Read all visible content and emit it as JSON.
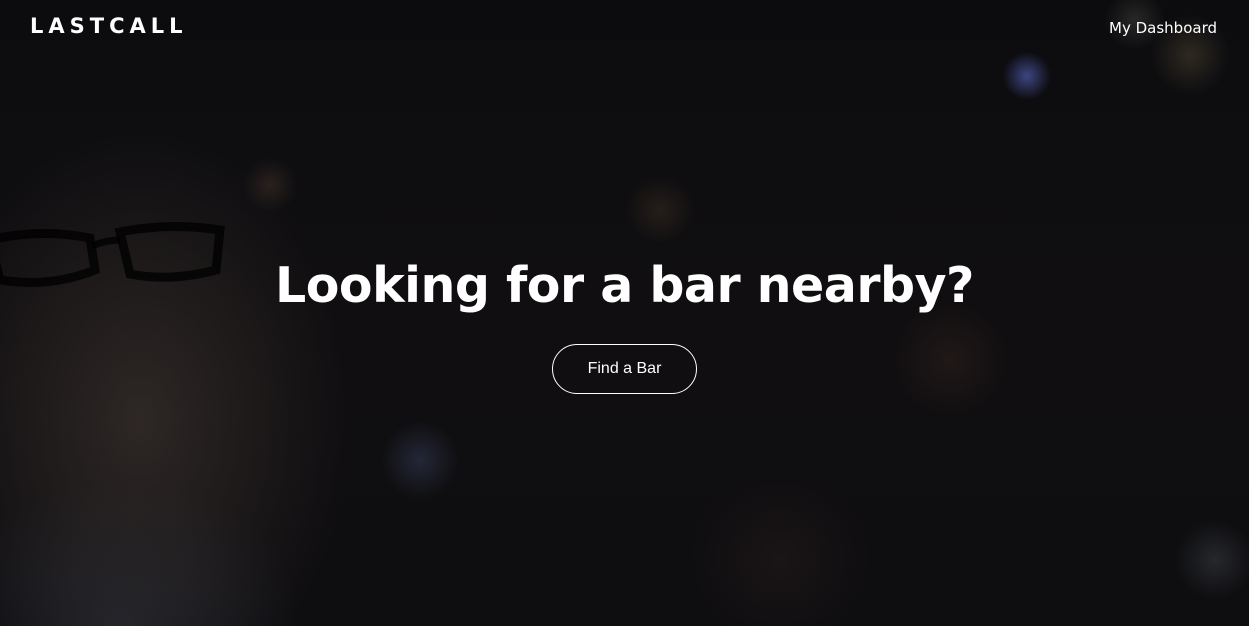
{
  "header": {
    "logo_text": "LASTCALL",
    "nav_dashboard_label": "My Dashboard"
  },
  "hero": {
    "headline": "Looking for a bar nearby?",
    "cta_label": "Find a Bar",
    "background_image": "blurred-bar-scene-with-smiling-man-in-glasses"
  },
  "colors": {
    "text": "#ffffff",
    "background": "#0a0a0c",
    "button_border": "#ffffff"
  }
}
